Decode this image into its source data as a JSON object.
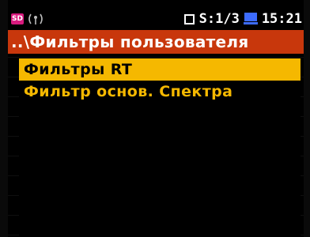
{
  "status": {
    "sd_label": "SD",
    "measurement": "S:1/3",
    "time": "15:21"
  },
  "breadcrumb": {
    "text": "..\\Фильтры пользователя"
  },
  "menu": {
    "items": [
      {
        "label": "Фильтры RT",
        "selected": true
      },
      {
        "label": "Фильтр основ. Спектра",
        "selected": false
      }
    ]
  },
  "colors": {
    "breadcrumb_bg": "#c8370c",
    "highlight": "#f5b800",
    "item_text": "#f5b800",
    "sd_icon": "#d81b7e",
    "pc_icon": "#3d6cff"
  }
}
